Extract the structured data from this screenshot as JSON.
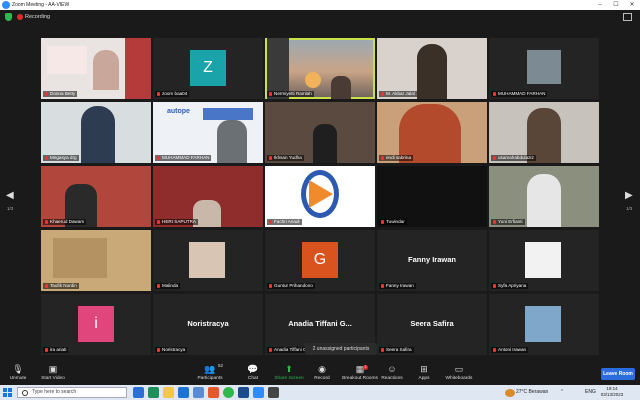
{
  "window": {
    "title": "Zoom Meeting - AA-VIEW",
    "controls": [
      "–",
      "☐",
      "✕"
    ]
  },
  "recording": {
    "label": "Recording"
  },
  "navigation": {
    "prev": "◀",
    "next": "▶",
    "page_left": "1/3",
    "page_right": "1/3"
  },
  "participants": [
    {
      "name": "Donna Betty"
    },
    {
      "name": "zoom baa04",
      "initial": "Z",
      "color": "#1aa3a8"
    },
    {
      "name": "Nermiyetti Ramlah"
    },
    {
      "name": "M. Akbar Jalal"
    },
    {
      "name": "MUHAMMAD FARHAN"
    },
    {
      "name": "Megasya drg"
    },
    {
      "name": "MUHAMMAD FARHAN",
      "slide_text": "autope"
    },
    {
      "name": "Ikhsan Yudha"
    },
    {
      "name": "endi sabrina"
    },
    {
      "name": "usamahabdulaziz"
    },
    {
      "name": "Khaerud Dawam"
    },
    {
      "name": "HERI SAPUTRA"
    },
    {
      "name": "Fachri Ariadi"
    },
    {
      "name": "Tuwindar"
    },
    {
      "name": "Yuni Erfianti"
    },
    {
      "name": "Taufik Nurdin"
    },
    {
      "name": "Malinda"
    },
    {
      "name": "Guntur Prihandono",
      "initial": "G",
      "color": "#d9531e"
    },
    {
      "name": "Fanny Irawan",
      "display": "Fanny Irawan"
    },
    {
      "name": "Syfa Apriyana"
    },
    {
      "name": "ira ariati",
      "initial": "i",
      "color": "#e0457b"
    },
    {
      "name": "Noristracya",
      "display": "Noristracya"
    },
    {
      "name": "Anadia Tiffani G...",
      "display": "Anadia Tiffani G..."
    },
    {
      "name": "Seera Safira",
      "display": "Seera Safira"
    },
    {
      "name": "Antoni Irawan"
    }
  ],
  "tooltip": {
    "unassigned": "2 unassigned participants"
  },
  "toolbar": {
    "unmute": "Unmute",
    "start_video": "Start Video",
    "participants": "Participants",
    "participants_count": "52",
    "chat": "Chat",
    "share_screen": "Share Screen",
    "record": "Record",
    "breakout": "Breakout Rooms",
    "reactions": "Reactions",
    "apps": "Apps",
    "whiteboards": "Whiteboards",
    "leave": "Leave Room",
    "breakout_badge": "2"
  },
  "taskbar": {
    "search_placeholder": "Type here to search",
    "weather": "27°C Berawan",
    "lang": "ENG",
    "time": "19:14",
    "date": "03/13/2023"
  },
  "colors": {
    "active_speaker": "#c8e04a",
    "share_green": "#2fb84e",
    "leave_blue": "#2d6cdf"
  }
}
